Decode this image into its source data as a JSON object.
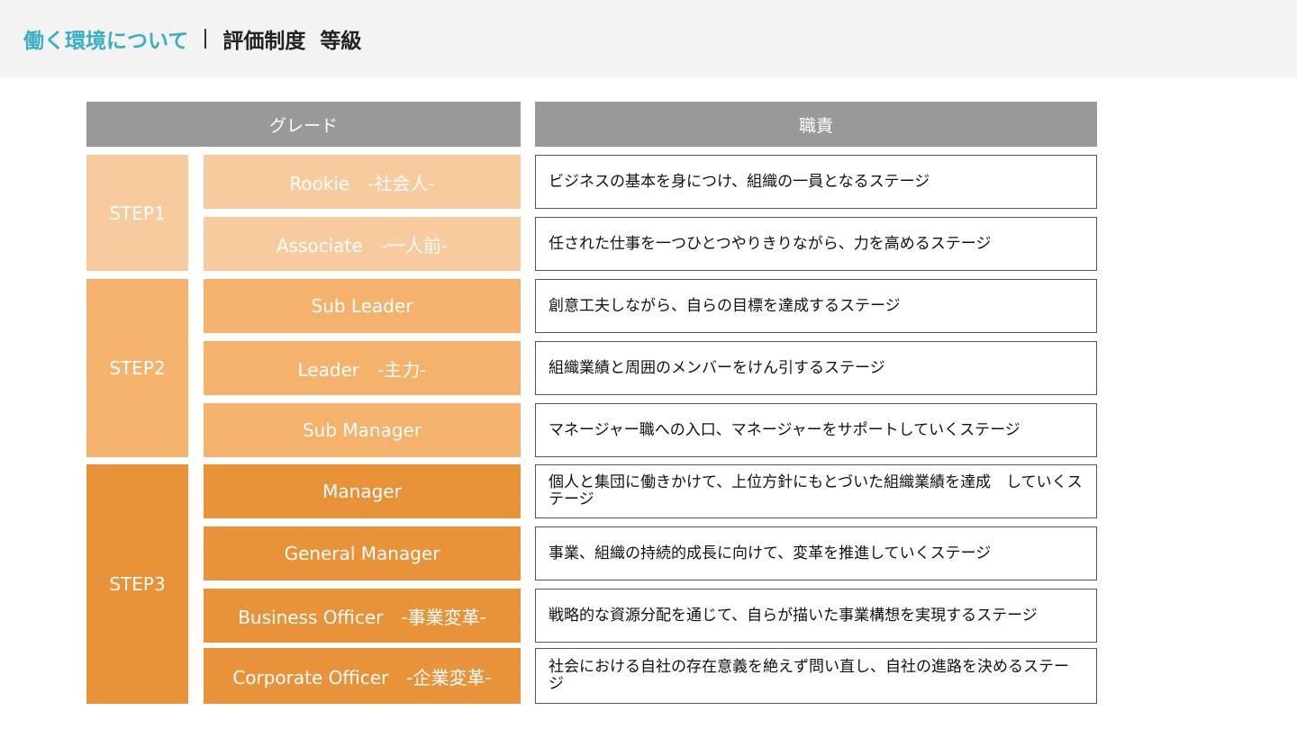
{
  "header": {
    "section": "働く環境について",
    "title": "評価制度",
    "subtitle": "等級"
  },
  "columns": {
    "grade": "グレード",
    "duty": "職責"
  },
  "steps": [
    {
      "label": "STEP1",
      "color": "#f8cb9e"
    },
    {
      "label": "STEP2",
      "color": "#f5b26d"
    },
    {
      "label": "STEP3",
      "color": "#e8923a"
    }
  ],
  "rows": [
    {
      "grade": "Rookie　-社会人-",
      "duty": "ビジネスの基本を身につけ、組織の一員となるステージ"
    },
    {
      "grade": "Associate　-一人前-",
      "duty": "任された仕事を一つひとつやりきりながら、力を高めるステージ"
    },
    {
      "grade": "Sub Leader",
      "duty": "創意工夫しながら、自らの目標を達成するステージ"
    },
    {
      "grade": "Leader　-主力-",
      "duty": "組織業績と周囲のメンバーをけん引するステージ"
    },
    {
      "grade": "Sub Manager",
      "duty": "マネージャー職への入口、マネージャーをサポートしていくステージ"
    },
    {
      "grade": "Manager",
      "duty": "個人と集団に働きかけて、上位方針にもとづいた組織業績を達成　していくステージ"
    },
    {
      "grade": "General Manager",
      "duty": "事業、組織の持続的成長に向けて、変革を推進していくステージ"
    },
    {
      "grade": "Business Officer　-事業変革-",
      "duty": "戦略的な資源分配を通じて、自らが描いた事業構想を実現するステージ"
    },
    {
      "grade": "Corporate Officer　-企業変革-",
      "duty": "社会における自社の存在意義を絶えず問い直し、自社の進路を決めるステージ"
    }
  ]
}
